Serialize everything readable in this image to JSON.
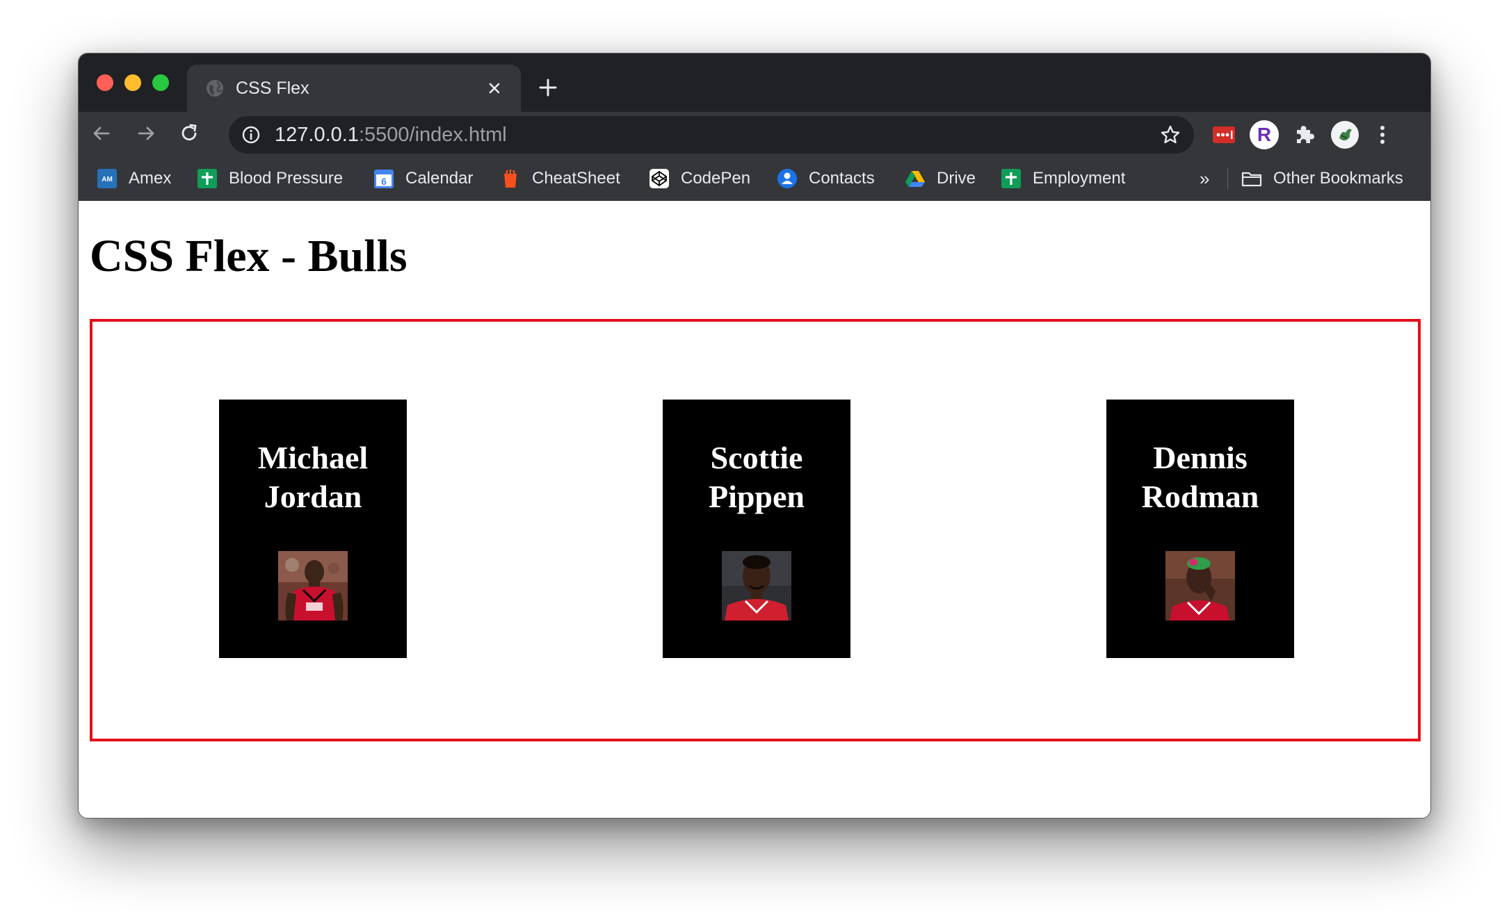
{
  "browser": {
    "tab": {
      "title": "CSS Flex"
    },
    "address": {
      "host": "127.0.0.1",
      "rest": ":5500/index.html"
    },
    "bookmarks": [
      {
        "label": "Amex",
        "icon": "amex-icon"
      },
      {
        "label": "Blood Pressure",
        "icon": "sheets-icon"
      },
      {
        "label": "Calendar",
        "icon": "calendar-icon"
      },
      {
        "label": "CheatSheet",
        "icon": "cheatsheet-icon"
      },
      {
        "label": "CodePen",
        "icon": "codepen-icon"
      },
      {
        "label": "Contacts",
        "icon": "contacts-icon"
      },
      {
        "label": "Drive",
        "icon": "drive-icon"
      },
      {
        "label": "Employment",
        "icon": "sheets-icon"
      }
    ],
    "bookmarks_more": "»",
    "other_bookmarks": "Other Bookmarks",
    "calendar_day": "6",
    "profile_letter": "R"
  },
  "page": {
    "heading": "CSS Flex - Bulls",
    "cards": [
      {
        "name": "Michael\nJordan",
        "photo": "jordan-photo"
      },
      {
        "name": "Scottie\nPippen",
        "photo": "pippen-photo"
      },
      {
        "name": "Dennis\nRodman",
        "photo": "rodman-photo"
      }
    ]
  },
  "colors": {
    "frame": "#202124",
    "toolbar": "#35363a",
    "container_border": "#e3101a",
    "card": "#000000"
  }
}
